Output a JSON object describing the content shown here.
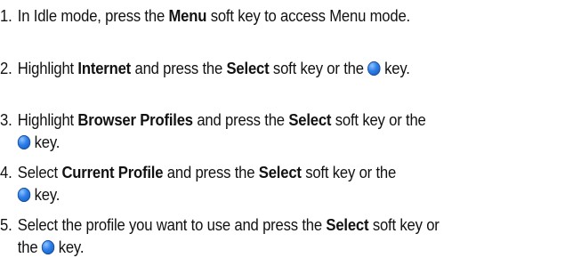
{
  "steps": [
    {
      "number": "1.",
      "t1": "In Idle mode, press the ",
      "b1": "Menu",
      "t2": " soft key to access Menu mode."
    },
    {
      "number": "2.",
      "t1": "Highlight ",
      "b1": "Internet",
      "t2": " and press the ",
      "b2": "Select",
      "t3": " soft key or the ",
      "t4": " key."
    },
    {
      "number": "3.",
      "t1": "Highlight ",
      "b1": "Browser Profiles",
      "t2": " and press the ",
      "b2": "Select",
      "t3": " soft key or the",
      "t4": " key."
    },
    {
      "number": "4.",
      "t1": "Select ",
      "b1": "Current Profile",
      "t2": " and press the ",
      "b2": "Select",
      "t3": " soft key or the",
      "t4": " key."
    },
    {
      "number": "5.",
      "t1": "Select the profile you want to use and press the ",
      "b1": "Select",
      "t2": " soft key or",
      "t3": "the ",
      "t4": " key."
    }
  ],
  "icons": {
    "key": "blue-circle-key-icon",
    "key_color": "#2f7fe8"
  }
}
